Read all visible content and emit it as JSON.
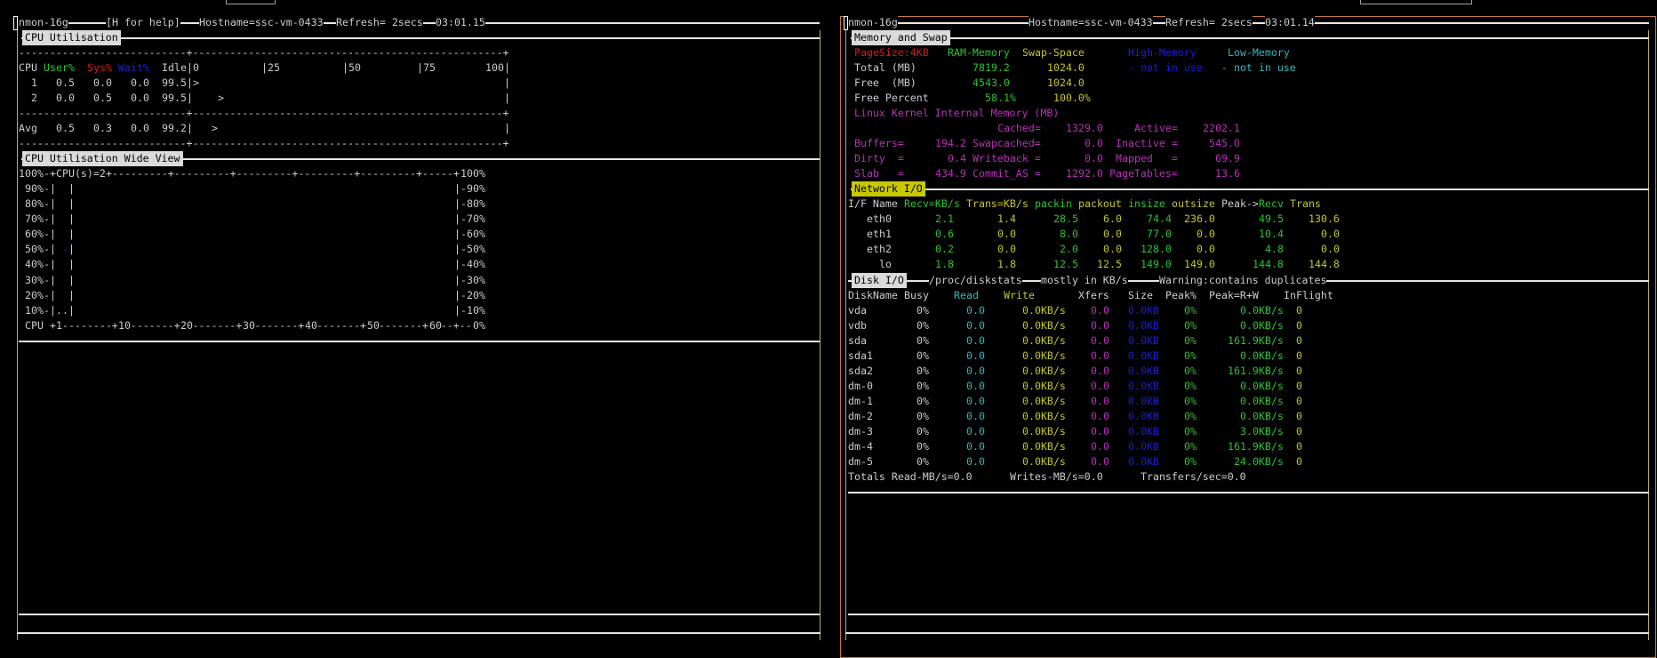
{
  "colors": {
    "green": "#2ec42e",
    "yellow": "#c6c62c",
    "red": "#d41c1c",
    "blue": "#1c1cdc",
    "cyan": "#36b6c0",
    "magenta": "#b832b8",
    "white": "#cccccc",
    "label_bg": "#dadada",
    "network_label_bg": "#c8c800"
  },
  "left": {
    "title": {
      "program": "nmon-16g",
      "help": "[H for help]",
      "hostname": "Hostname=ssc-vm-0433",
      "refresh": "Refresh= 2secs",
      "time": "03:01.15"
    },
    "cpu": {
      "label": "CPU Utilisation",
      "headers": {
        "cpu": "CPU",
        "user": "User%",
        "sys": "Sys%",
        "wait": "Wait%",
        "idle": "Idle"
      },
      "scale": [
        "0",
        "25",
        "50",
        "75",
        "100"
      ],
      "rows": [
        {
          "cpu": "1",
          "user": "0.5",
          "sys": "0.0",
          "wait": "0.0",
          "idle": "99.5",
          "marker": ">"
        },
        {
          "cpu": "2",
          "user": "0.0",
          "sys": "0.5",
          "wait": "0.0",
          "idle": "99.5",
          "marker": ">"
        }
      ],
      "avg": {
        "cpu": "Avg",
        "user": "0.5",
        "sys": "0.3",
        "wait": "0.0",
        "idle": "99.2",
        "marker": ">"
      }
    },
    "wide": {
      "label": "CPU Utilisation Wide View",
      "top_left": "100%",
      "cpus": "CPU(s)=2",
      "top_right": "100%",
      "y_ticks_left": [
        "90%",
        "80%",
        "70%",
        "60%",
        "50%",
        "40%",
        "30%",
        "20%",
        "10%"
      ],
      "y_ticks_right": [
        "90%",
        "80%",
        "70%",
        "60%",
        "50%",
        "40%",
        "30%",
        "20%",
        "10%"
      ],
      "x_label": "CPU",
      "x_ticks": [
        "1",
        "10",
        "20",
        "30",
        "40",
        "50",
        "60"
      ],
      "bottom_right": "0%",
      "low_usage_marks": [
        ".",
        "."
      ],
      "wait_mark": "-"
    }
  },
  "right": {
    "title": {
      "program": "nmon-16g",
      "hostname": "Hostname=ssc-vm-0433",
      "refresh": "Refresh= 2secs",
      "time": "03:01.14"
    },
    "memory": {
      "label": "Memory and Swap",
      "headers": {
        "pagesize": "PageSize:4KB",
        "ram": "RAM-Memory",
        "swap": "Swap-Space",
        "high": "High-Memory",
        "low": "Low-Memory"
      },
      "rows": [
        {
          "label": "Total (MB)",
          "ram": "7819.2",
          "swap": "1024.0",
          "high": "- not in use",
          "low": "- not in use"
        },
        {
          "label": "Free  (MB)",
          "ram": "4543.0",
          "swap": "1024.0"
        },
        {
          "label": "Free Percent",
          "ram": "58.1%",
          "swap": "100.0%"
        }
      ],
      "kernel_title": "Linux Kernel Internal Memory (MB)",
      "kernel": [
        {
          "l1": "",
          "v1": "",
          "l2": "Cached=",
          "v2": "1329.0",
          "l3": "Active=",
          "v3": "2202.1"
        },
        {
          "l1": "Buffers=",
          "v1": "194.2",
          "l2": "Swapcached=",
          "v2": "0.0",
          "l3": "Inactive =",
          "v3": "545.0"
        },
        {
          "l1": "Dirty  =",
          "v1": "0.4",
          "l2": "Writeback =",
          "v2": "0.0",
          "l3": "Mapped   =",
          "v3": "69.9"
        },
        {
          "l1": "Slab   =",
          "v1": "434.9",
          "l2": "Commit_AS =",
          "v2": "1292.0",
          "l3": "PageTables=",
          "v3": "13.6"
        }
      ]
    },
    "network": {
      "label": "Network I/O",
      "headers": [
        "I/F Name",
        "Recv=KB/s",
        "Trans=KB/s",
        "packin",
        "packout",
        "insize",
        "outsize",
        "Peak->",
        "Recv",
        "Trans"
      ],
      "rows": [
        {
          "name": "eth0",
          "recv": "2.1",
          "trans": "1.4",
          "packin": "28.5",
          "packout": "6.0",
          "insize": "74.4",
          "outsize": "236.0",
          "peak_recv": "49.5",
          "peak_trans": "130.6"
        },
        {
          "name": "eth1",
          "recv": "0.6",
          "trans": "0.0",
          "packin": "8.0",
          "packout": "0.0",
          "insize": "77.0",
          "outsize": "0.0",
          "peak_recv": "10.4",
          "peak_trans": "0.0"
        },
        {
          "name": "eth2",
          "recv": "0.2",
          "trans": "0.0",
          "packin": "2.0",
          "packout": "0.0",
          "insize": "128.0",
          "outsize": "0.0",
          "peak_recv": "4.8",
          "peak_trans": "0.0"
        },
        {
          "name": "lo",
          "recv": "1.8",
          "trans": "1.8",
          "packin": "12.5",
          "packout": "12.5",
          "insize": "149.0",
          "outsize": "149.0",
          "peak_recv": "144.8",
          "peak_trans": "144.8"
        }
      ]
    },
    "disk": {
      "label": "Disk I/O",
      "source": "/proc/diskstats",
      "units_note": "mostly in KB/s",
      "warning": "Warning:contains duplicates",
      "headers": [
        "DiskName",
        "Busy",
        "Read",
        "Write",
        "Xfers",
        "Size",
        "Peak%",
        "Peak=R+W",
        "InFlight"
      ],
      "rows": [
        {
          "name": "vda",
          "busy": "0%",
          "read": "0.0",
          "write": "0.0KB/s",
          "xfers": "0.0",
          "size": "0.0KB",
          "peak": "0%",
          "peak_rw": "0.0KB/s",
          "inflight": "0"
        },
        {
          "name": "vdb",
          "busy": "0%",
          "read": "0.0",
          "write": "0.0KB/s",
          "xfers": "0.0",
          "size": "0.0KB",
          "peak": "0%",
          "peak_rw": "0.0KB/s",
          "inflight": "0"
        },
        {
          "name": "sda",
          "busy": "0%",
          "read": "0.0",
          "write": "0.0KB/s",
          "xfers": "0.0",
          "size": "0.0KB",
          "peak": "0%",
          "peak_rw": "161.9KB/s",
          "inflight": "0"
        },
        {
          "name": "sda1",
          "busy": "0%",
          "read": "0.0",
          "write": "0.0KB/s",
          "xfers": "0.0",
          "size": "0.0KB",
          "peak": "0%",
          "peak_rw": "0.0KB/s",
          "inflight": "0"
        },
        {
          "name": "sda2",
          "busy": "0%",
          "read": "0.0",
          "write": "0.0KB/s",
          "xfers": "0.0",
          "size": "0.0KB",
          "peak": "0%",
          "peak_rw": "161.9KB/s",
          "inflight": "0"
        },
        {
          "name": "dm-0",
          "busy": "0%",
          "read": "0.0",
          "write": "0.0KB/s",
          "xfers": "0.0",
          "size": "0.0KB",
          "peak": "0%",
          "peak_rw": "0.0KB/s",
          "inflight": "0"
        },
        {
          "name": "dm-1",
          "busy": "0%",
          "read": "0.0",
          "write": "0.0KB/s",
          "xfers": "0.0",
          "size": "0.0KB",
          "peak": "0%",
          "peak_rw": "0.0KB/s",
          "inflight": "0"
        },
        {
          "name": "dm-2",
          "busy": "0%",
          "read": "0.0",
          "write": "0.0KB/s",
          "xfers": "0.0",
          "size": "0.0KB",
          "peak": "0%",
          "peak_rw": "0.0KB/s",
          "inflight": "0"
        },
        {
          "name": "dm-3",
          "busy": "0%",
          "read": "0.0",
          "write": "0.0KB/s",
          "xfers": "0.0",
          "size": "0.0KB",
          "peak": "0%",
          "peak_rw": "3.0KB/s",
          "inflight": "0"
        },
        {
          "name": "dm-4",
          "busy": "0%",
          "read": "0.0",
          "write": "0.0KB/s",
          "xfers": "0.0",
          "size": "0.0KB",
          "peak": "0%",
          "peak_rw": "161.9KB/s",
          "inflight": "0"
        },
        {
          "name": "dm-5",
          "busy": "0%",
          "read": "0.0",
          "write": "0.0KB/s",
          "xfers": "0.0",
          "size": "0.0KB",
          "peak": "0%",
          "peak_rw": "24.0KB/s",
          "inflight": "0"
        }
      ],
      "totals": {
        "read": "Totals Read-MB/s=0.0",
        "writes": "Writes-MB/s=0.0",
        "transfers": "Transfers/sec=0.0"
      }
    }
  }
}
